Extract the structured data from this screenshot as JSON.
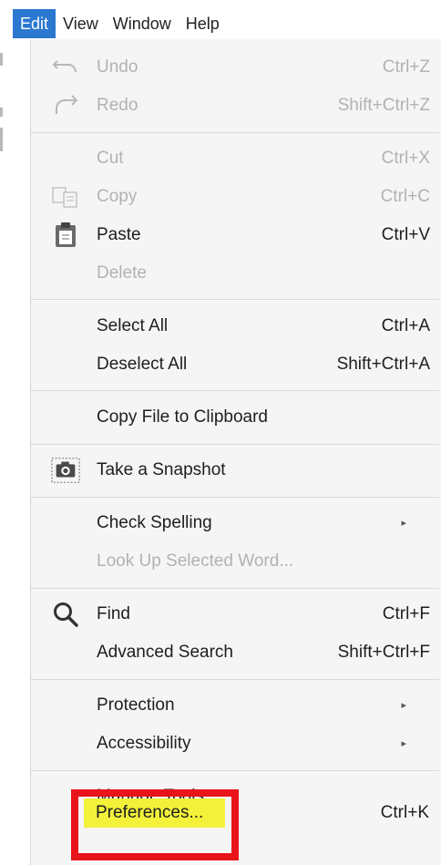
{
  "menubar": {
    "items": [
      "Edit",
      "View",
      "Window",
      "Help"
    ],
    "active": "Edit"
  },
  "colors": {
    "active_menu_bg": "#2b78d0",
    "menu_bg": "#f5f5f5",
    "disabled_text": "#b2b2b2",
    "highlight": "#f3f13a",
    "annotation_box": "#e8141a"
  },
  "menu": {
    "undo": {
      "label": "Undo",
      "shortcut": "Ctrl+Z",
      "icon": "undo-icon",
      "enabled": false
    },
    "redo": {
      "label": "Redo",
      "shortcut": "Shift+Ctrl+Z",
      "icon": "redo-icon",
      "enabled": false
    },
    "cut": {
      "label": "Cut",
      "shortcut": "Ctrl+X",
      "enabled": false
    },
    "copy": {
      "label": "Copy",
      "shortcut": "Ctrl+C",
      "icon": "copy-icon",
      "enabled": false
    },
    "paste": {
      "label": "Paste",
      "shortcut": "Ctrl+V",
      "icon": "clipboard-icon",
      "enabled": true
    },
    "delete": {
      "label": "Delete",
      "enabled": false
    },
    "select_all": {
      "label": "Select All",
      "shortcut": "Ctrl+A",
      "enabled": true
    },
    "deselect_all": {
      "label": "Deselect All",
      "shortcut": "Shift+Ctrl+A",
      "enabled": true
    },
    "copy_file": {
      "label": "Copy File to Clipboard",
      "enabled": true
    },
    "snapshot": {
      "label": "Take a Snapshot",
      "icon": "camera-icon",
      "enabled": true
    },
    "check_spelling": {
      "label": "Check Spelling",
      "submenu": true,
      "enabled": true
    },
    "look_up": {
      "label": "Look Up Selected Word...",
      "enabled": false
    },
    "find": {
      "label": "Find",
      "shortcut": "Ctrl+F",
      "icon": "search-icon",
      "enabled": true
    },
    "advanced_search": {
      "label": "Advanced Search",
      "shortcut": "Shift+Ctrl+F",
      "enabled": true
    },
    "protection": {
      "label": "Protection",
      "submenu": true,
      "enabled": true
    },
    "accessibility": {
      "label": "Accessibility",
      "submenu": true,
      "enabled": true
    },
    "manage_tools": {
      "label": "Manage Tools",
      "enabled": true
    },
    "preferences": {
      "label": "Preferences...",
      "shortcut": "Ctrl+K",
      "enabled": true,
      "highlighted": true
    }
  },
  "submenu_arrow": "▸"
}
